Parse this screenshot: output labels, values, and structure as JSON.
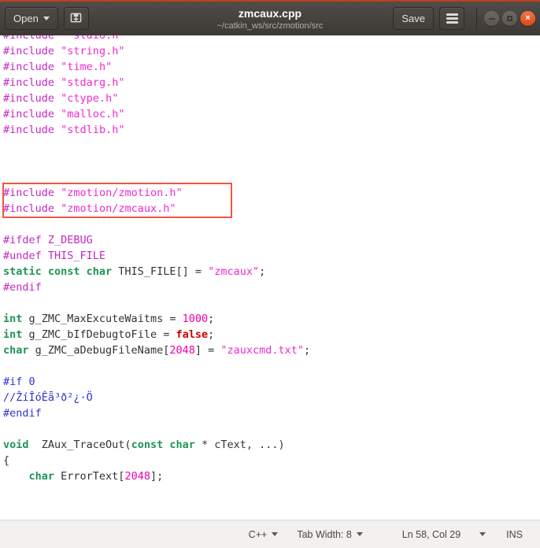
{
  "window": {
    "title": "zmcaux.cpp",
    "subtitle": "~/catkin_ws/src/zmotion/src",
    "open_label": "Open",
    "save_label": "Save",
    "new_doc_icon": "new-document-icon",
    "menu_icon": "hamburger-menu-icon",
    "open_caret_icon": "chevron-down-icon",
    "minimize_icon": "minimize-icon",
    "maximize_icon": "maximize-icon",
    "close_icon": "close-icon",
    "close_glyph": "×"
  },
  "editor": {
    "lines": [
      [
        {
          "t": "pre",
          "s": "#include"
        },
        {
          "t": "plain",
          "s": "  "
        },
        {
          "t": "str",
          "s": "\"stdio.h\""
        }
      ],
      [
        {
          "t": "pre",
          "s": "#include"
        },
        {
          "t": "plain",
          "s": " "
        },
        {
          "t": "str",
          "s": "\"string.h\""
        }
      ],
      [
        {
          "t": "pre",
          "s": "#include"
        },
        {
          "t": "plain",
          "s": " "
        },
        {
          "t": "str",
          "s": "\"time.h\""
        }
      ],
      [
        {
          "t": "pre",
          "s": "#include"
        },
        {
          "t": "plain",
          "s": " "
        },
        {
          "t": "str",
          "s": "\"stdarg.h\""
        }
      ],
      [
        {
          "t": "pre",
          "s": "#include"
        },
        {
          "t": "plain",
          "s": " "
        },
        {
          "t": "str",
          "s": "\"ctype.h\""
        }
      ],
      [
        {
          "t": "pre",
          "s": "#include"
        },
        {
          "t": "plain",
          "s": " "
        },
        {
          "t": "str",
          "s": "\"malloc.h\""
        }
      ],
      [
        {
          "t": "pre",
          "s": "#include"
        },
        {
          "t": "plain",
          "s": " "
        },
        {
          "t": "str",
          "s": "\"stdlib.h\""
        }
      ],
      [],
      [],
      [],
      [
        {
          "t": "pre",
          "s": "#include"
        },
        {
          "t": "plain",
          "s": " "
        },
        {
          "t": "str",
          "s": "\"zmotion/zmotion.h\""
        }
      ],
      [
        {
          "t": "pre",
          "s": "#include"
        },
        {
          "t": "plain",
          "s": " "
        },
        {
          "t": "str",
          "s": "\"zmotion/zmcaux.h\""
        }
      ],
      [],
      [
        {
          "t": "pre",
          "s": "#ifdef Z_DEBUG"
        }
      ],
      [
        {
          "t": "pre",
          "s": "#undef THIS_FILE"
        }
      ],
      [
        {
          "t": "kw",
          "s": "static const char"
        },
        {
          "t": "plain",
          "s": " THIS_FILE[] = "
        },
        {
          "t": "str",
          "s": "\"zmcaux\""
        },
        {
          "t": "plain",
          "s": ";"
        }
      ],
      [
        {
          "t": "pre",
          "s": "#endif"
        }
      ],
      [],
      [
        {
          "t": "kw",
          "s": "int"
        },
        {
          "t": "plain",
          "s": " g_ZMC_MaxExcuteWaitms = "
        },
        {
          "t": "num",
          "s": "1000"
        },
        {
          "t": "plain",
          "s": ";"
        }
      ],
      [
        {
          "t": "kw",
          "s": "int"
        },
        {
          "t": "plain",
          "s": " g_ZMC_bIfDebugtoFile = "
        },
        {
          "t": "false",
          "s": "false"
        },
        {
          "t": "plain",
          "s": ";"
        }
      ],
      [
        {
          "t": "kw",
          "s": "char"
        },
        {
          "t": "plain",
          "s": " g_ZMC_aDebugFileName["
        },
        {
          "t": "num",
          "s": "2048"
        },
        {
          "t": "plain",
          "s": "] = "
        },
        {
          "t": "str",
          "s": "\"zauxcmd.txt\""
        },
        {
          "t": "plain",
          "s": ";"
        }
      ],
      [],
      [
        {
          "t": "dis",
          "s": "#if 0"
        }
      ],
      [
        {
          "t": "dis",
          "s": "//ŽíÎóÊǟ³ð²¿·Ö"
        }
      ],
      [
        {
          "t": "dis",
          "s": "#endif"
        }
      ],
      [],
      [
        {
          "t": "kw",
          "s": "void"
        },
        {
          "t": "plain",
          "s": "  ZAux_TraceOut("
        },
        {
          "t": "kw",
          "s": "const char"
        },
        {
          "t": "plain",
          "s": " * cText, ...)"
        }
      ],
      [
        {
          "t": "plain",
          "s": "{"
        }
      ],
      [
        {
          "t": "plain",
          "s": "    "
        },
        {
          "t": "kw",
          "s": "char"
        },
        {
          "t": "plain",
          "s": " ErrorText["
        },
        {
          "t": "num",
          "s": "2048"
        },
        {
          "t": "plain",
          "s": "];"
        }
      ]
    ],
    "annotation": {
      "name": "red-highlight-box",
      "color": "#f4553f",
      "covers_lines": [
        "#include \"zmotion/zmotion.h\"",
        "#include \"zmotion/zmcaux.h\""
      ]
    },
    "caret": {
      "after_text": "#include \"zmotion/zmotion.h\"",
      "color": "#3b3b3b"
    }
  },
  "statusbar": {
    "language": "C++",
    "tab_width": "Tab Width: 8",
    "position": "Ln 58, Col 29",
    "insert_mode": "INS",
    "caret_icon": "chevron-down-icon"
  },
  "colors": {
    "titlebar_top_accent": "#c0401a",
    "titlebar_bg": "#3f3b37",
    "close_button": "#dd4814",
    "preprocessor": "#c328c3",
    "string": "#ef2ad0",
    "keyword": "#1f9456",
    "number": "#f000b0",
    "boolean": "#cc0000",
    "disabled_block": "#3333cc",
    "statusbar_bg": "#f2f1f0"
  }
}
